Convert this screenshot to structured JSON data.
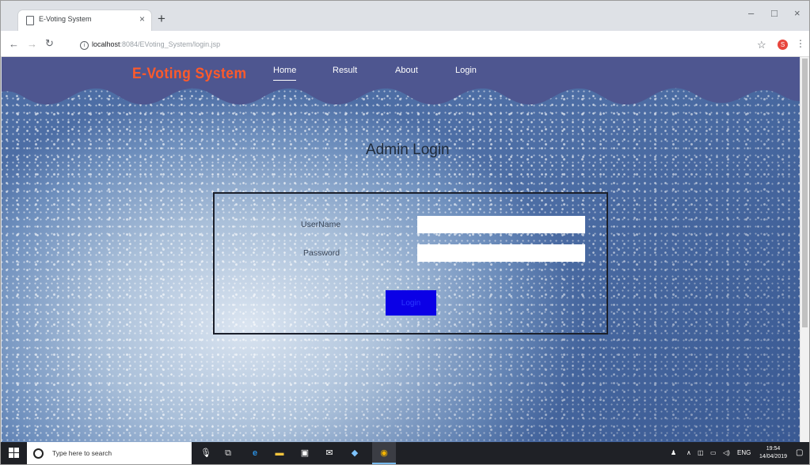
{
  "browser": {
    "tab_title": "E-Voting System",
    "tab_close": "×",
    "new_tab": "+",
    "win_min": "–",
    "win_max": "□",
    "win_close": "×",
    "url_host": "localhost",
    "url_path": ":8084/EVoting_System/login.jsp",
    "profile_initial": "S"
  },
  "site": {
    "brand": "E-Voting System",
    "nav": {
      "home": "Home",
      "result": "Result",
      "about": "About",
      "login": "Login"
    },
    "page_title": "Admin Login",
    "form": {
      "username_label": "UserName",
      "password_label": "Password",
      "username_value": "",
      "password_value": "",
      "submit_label": "Login"
    },
    "colors": {
      "brand": "#ff5a2b",
      "header": "#4e5690",
      "button": "#0b00e6"
    }
  },
  "taskbar": {
    "search_placeholder": "Type here to search",
    "language": "ENG",
    "time": "19:54",
    "date": "14/04/2019"
  }
}
